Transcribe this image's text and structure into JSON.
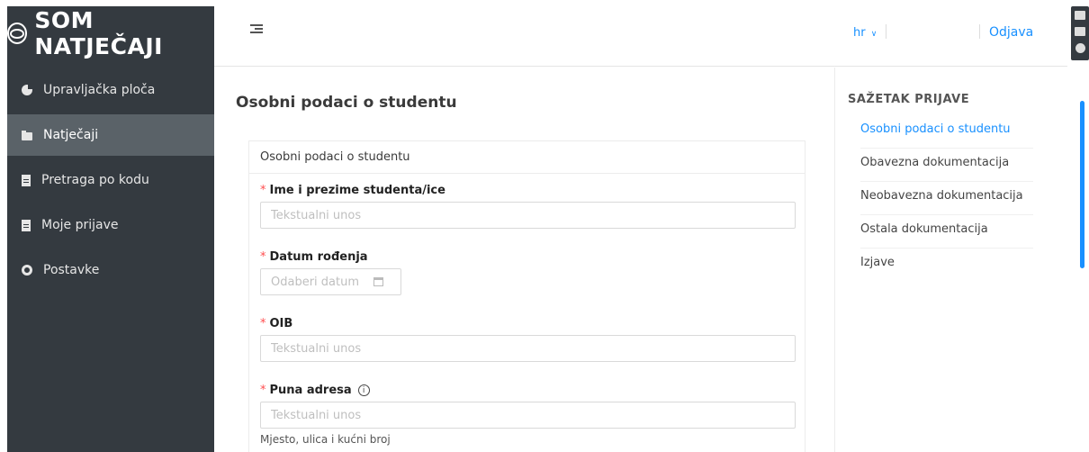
{
  "brand": {
    "name": "SOM NATJEČAJI"
  },
  "sidebar": {
    "items": [
      {
        "label": "Upravljačka ploča",
        "icon": "pie-chart-icon"
      },
      {
        "label": "Natječaji",
        "icon": "folder-open-icon",
        "active": true
      },
      {
        "label": "Pretraga po kodu",
        "icon": "file-icon"
      },
      {
        "label": "Moje prijave",
        "icon": "file-text-icon"
      },
      {
        "label": "Postavke",
        "icon": "gear-icon"
      }
    ]
  },
  "header": {
    "language": "hr",
    "logout_label": "Odjava"
  },
  "main": {
    "title": "Osobni podaci o studentu",
    "card_title": "Osobni podaci o studentu",
    "fields": {
      "name": {
        "label": "Ime i prezime studenta/ice",
        "placeholder": "Tekstualni unos"
      },
      "dob": {
        "label": "Datum rođenja",
        "placeholder": "Odaberi datum"
      },
      "oib": {
        "label": "OIB",
        "placeholder": "Tekstualni unos"
      },
      "address": {
        "label": "Puna adresa",
        "placeholder": "Tekstualni unos",
        "helper": "Mjesto, ulica i kućni broj"
      }
    }
  },
  "summary": {
    "title": "SAŽETAK PRIJAVE",
    "items": [
      {
        "label": "Osobni podaci o studentu",
        "active": true
      },
      {
        "label": "Obavezna dokumentacija"
      },
      {
        "label": "Neobavezna dokumentacija"
      },
      {
        "label": "Ostala dokumentacija"
      },
      {
        "label": "Izjave"
      }
    ]
  },
  "colors": {
    "accent": "#1890ff",
    "sidebar": "#343a40",
    "active_nav": "#5a6268",
    "required": "#ff4d4f"
  }
}
